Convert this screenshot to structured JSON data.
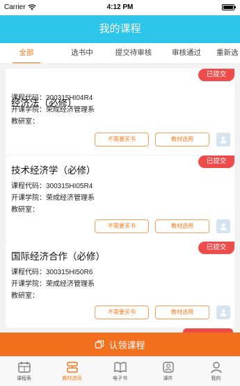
{
  "status_bar": {
    "carrier": "Carrier",
    "time": "4:12 PM"
  },
  "header": {
    "title": "我的课程"
  },
  "tabs": [
    {
      "label": "全部",
      "active": true
    },
    {
      "label": "选书中",
      "active": false
    },
    {
      "label": "提交待审核",
      "active": false
    },
    {
      "label": "审核通过",
      "active": false
    },
    {
      "label": "重新选",
      "active": false
    }
  ],
  "labels": {
    "code": "课程代码：",
    "college": "开课学院：",
    "office": "教研室："
  },
  "courses": [
    {
      "title": "经济法（必修）",
      "code": "300315HI04R4",
      "college": "荣成经济管理系",
      "office": "",
      "status": "已提交",
      "btn_no_book": "不需要买书",
      "btn_select": "教材选用"
    },
    {
      "title": "技术经济学（必修）",
      "code": "300315HI05R4",
      "college": "荣成经济管理系",
      "office": "",
      "status": "已提交",
      "btn_no_book": "不需要买书",
      "btn_select": "教材选用"
    },
    {
      "title": "国际经济合作（必修）",
      "code": "300315HI50R6",
      "college": "荣成经济管理系",
      "office": "",
      "status": "已提交",
      "btn_no_book": "不需要买书",
      "btn_select": "教材选用"
    }
  ],
  "cta": {
    "label": "认领课程",
    "icon": "claim-icon"
  },
  "tabbar": [
    {
      "label": "课程表",
      "icon": "calendar-icon",
      "active": false
    },
    {
      "label": "教材选用",
      "icon": "book-select-icon",
      "active": true
    },
    {
      "label": "电子书",
      "icon": "ebook-icon",
      "active": false
    },
    {
      "label": "课件",
      "icon": "courseware-icon",
      "active": false
    },
    {
      "label": "我的",
      "icon": "profile-icon",
      "active": false
    }
  ],
  "colors": {
    "header": "#2ec5ea",
    "accent": "#f47b1c",
    "badge": "#ee4b4b",
    "cta": "#f2701e"
  }
}
